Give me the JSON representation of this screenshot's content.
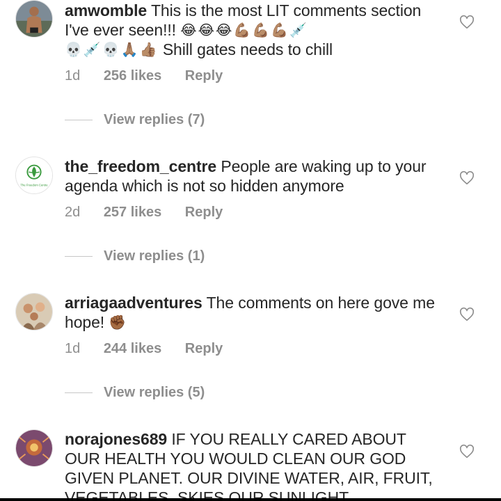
{
  "comments": [
    {
      "username": "amwomble",
      "text_parts": [
        "This is the most LIT comments section I've ever seen!!!",
        "Shill gates needs to chill"
      ],
      "emoji_runs": [
        "😂😂😂💪🏽💪🏽💪🏽💉",
        "💀💉💀🙏🏽👍🏽"
      ],
      "time": "1d",
      "likes": "256 likes",
      "reply": "Reply",
      "view_replies": "View replies (7)"
    },
    {
      "username": "the_freedom_centre",
      "text": "People are waking up to your agenda which is not so hidden anymore",
      "avatar_caption": "The Freedom Centre",
      "time": "2d",
      "likes": "257 likes",
      "reply": "Reply",
      "view_replies": "View replies (1)"
    },
    {
      "username": "arriagaadventures",
      "text": "The comments on here gove me hope!",
      "emoji_runs": [
        "✊🏾"
      ],
      "time": "1d",
      "likes": "244 likes",
      "reply": "Reply",
      "view_replies": "View replies (5)"
    },
    {
      "username": "norajones689",
      "text": "IF YOU REALLY CARED ABOUT OUR HEALTH YOU WOULD CLEAN OUR GOD GIVEN PLANET. OUR DIVINE WATER, AIR, FRUIT, VEGETABLES, SKIES,OUR SUNLIGHT"
    }
  ],
  "colors": {
    "text": "#262626",
    "secondary": "#8e8e8e",
    "divider": "#c7c7c7",
    "logo_green": "#3a9a3e"
  },
  "icons": [
    "heart-outline-icon",
    "avatar"
  ]
}
